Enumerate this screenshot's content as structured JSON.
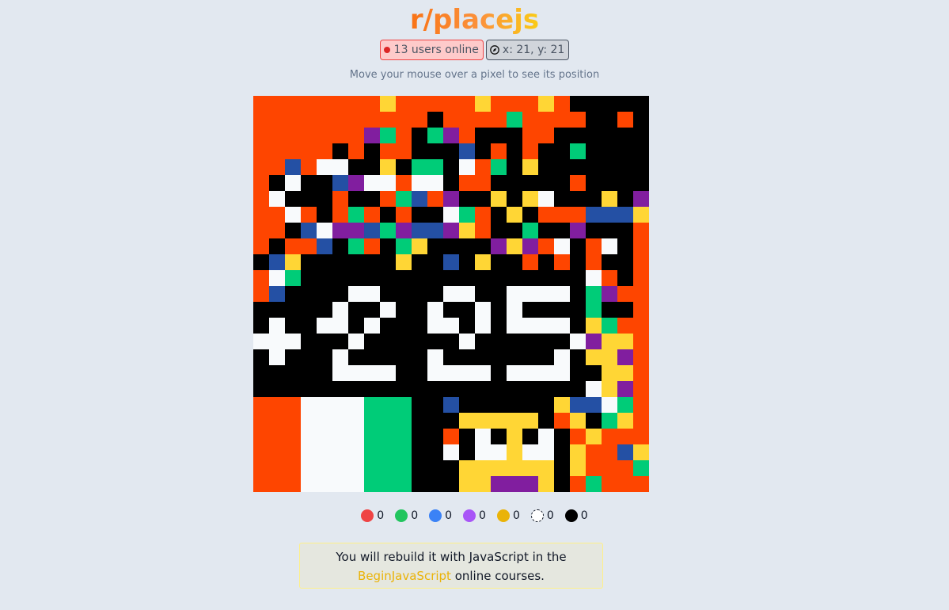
{
  "header": {
    "title": "r/placejs"
  },
  "status": {
    "online_label": "13 users online",
    "position_label": "x: 21, y: 21"
  },
  "hint": "Move your mouse over a pixel to see its position",
  "palette": {
    "O": "#fe4500",
    "G": "#00cc78",
    "B": "#2450a4",
    "P": "#811e9f",
    "Y": "#ffd635",
    "W": "#f8fafc",
    "K": "#000000"
  },
  "canvas": {
    "rows": [
      "OOOOOOOOYOOOOOYOOOYOKKKKK",
      "OOOOOOOOOOOKOOOOGOOOOKKOK",
      "OOOOOOOPGOKGPOKKKOOKKKKKK",
      "OOOOOKOKOOKKKBKOKOKKGKKKK",
      "OOBOWWKKYKGGKWOGKYKKKKKKK",
      "OKWKKBPWWOWWKOOKKKKKOKKKK",
      "OWKKKOKKOGBOPKKYKYWKKKYKP",
      "OOWOKOGOKOKKWGOKYKOOOBBBY",
      "OOKBWPPBGPBBPYOKKGKKPKKKO",
      "OKOOBKGOKGYKKKKPYPOWKOWKO",
      "KBYKKKKKKYKKBKYKKOKOKOKKO",
      "OWGKKKKKKKKKKKKKKKKKKWOKO",
      "OBKKKKWWKKKKWWKKWWWWKGPOO",
      "KKKKKWKKWKKWKKWKWKKKKGKKO",
      "KWKKWWKWKKKWWKWKWWWWKYGOO",
      "WWWKKKWKKKKKKWKKKKKKWPYYO",
      "KWKKKWKKKKKWKKKKKKKWKYYPO",
      "KKKKKWWWWKKWWWWKWWWWKKYYO",
      "KKKKKKKKKKKKKKKKKKKKKWYPO",
      "OOOWWWWGGGKKBKKKKKKYBBWGO",
      "OOOWWWWGGGKKKYYYYYKOYKGYO",
      "OOOWWWWGGGKKOKWKYKWKOYOOO",
      "OOOWWWWGGGKKWKWWYWWKYOOBYO",
      "OOOWWWWGGGKKKYYYYYYKYOOOGO",
      "OOOWWWWGGGKKKYYPPPYKOGOOOG"
    ]
  },
  "color_counts": [
    {
      "color": "#ef4444",
      "count": "0"
    },
    {
      "color": "#22c55e",
      "count": "0"
    },
    {
      "color": "#3b82f6",
      "count": "0"
    },
    {
      "color": "#a855f7",
      "count": "0"
    },
    {
      "color": "#eab308",
      "count": "0"
    },
    {
      "color": "#ffffff",
      "count": "0"
    },
    {
      "color": "#000000",
      "count": "0"
    }
  ],
  "footer": {
    "line1": "You will rebuild it with JavaScript in the",
    "link": "BeginJavaScript",
    "line2_suffix": " online courses."
  }
}
